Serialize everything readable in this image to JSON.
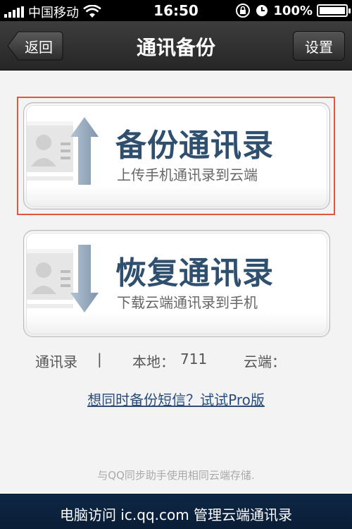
{
  "status_bar": {
    "carrier": "中国移动",
    "time": "16:50",
    "battery_text": "100%",
    "battery_level": 1.0
  },
  "nav": {
    "back_label": "返回",
    "title": "通讯备份",
    "settings_label": "设置"
  },
  "backup_card": {
    "title": "备份通讯录",
    "subtitle": "上传手机通讯录到云端",
    "icon": "contact-upload-icon"
  },
  "restore_card": {
    "title": "恢复通讯录",
    "subtitle": "下载云端通讯录到手机",
    "icon": "contact-download-icon"
  },
  "stats": {
    "label": "通讯录",
    "separator": "|",
    "local_label": "本地：",
    "local_value": "711",
    "cloud_label": "云端："
  },
  "pro_link": "想同时备份短信？试试Pro版",
  "note": "与QQ同步助手使用相同云端存储.",
  "footer": "电脑访问 ic.qq.com 管理云端通讯录",
  "colors": {
    "title_blue": "#2f4f6e",
    "highlight": "#e0573a",
    "link": "#2a4d7a",
    "footer_bg": "#0e2746"
  }
}
